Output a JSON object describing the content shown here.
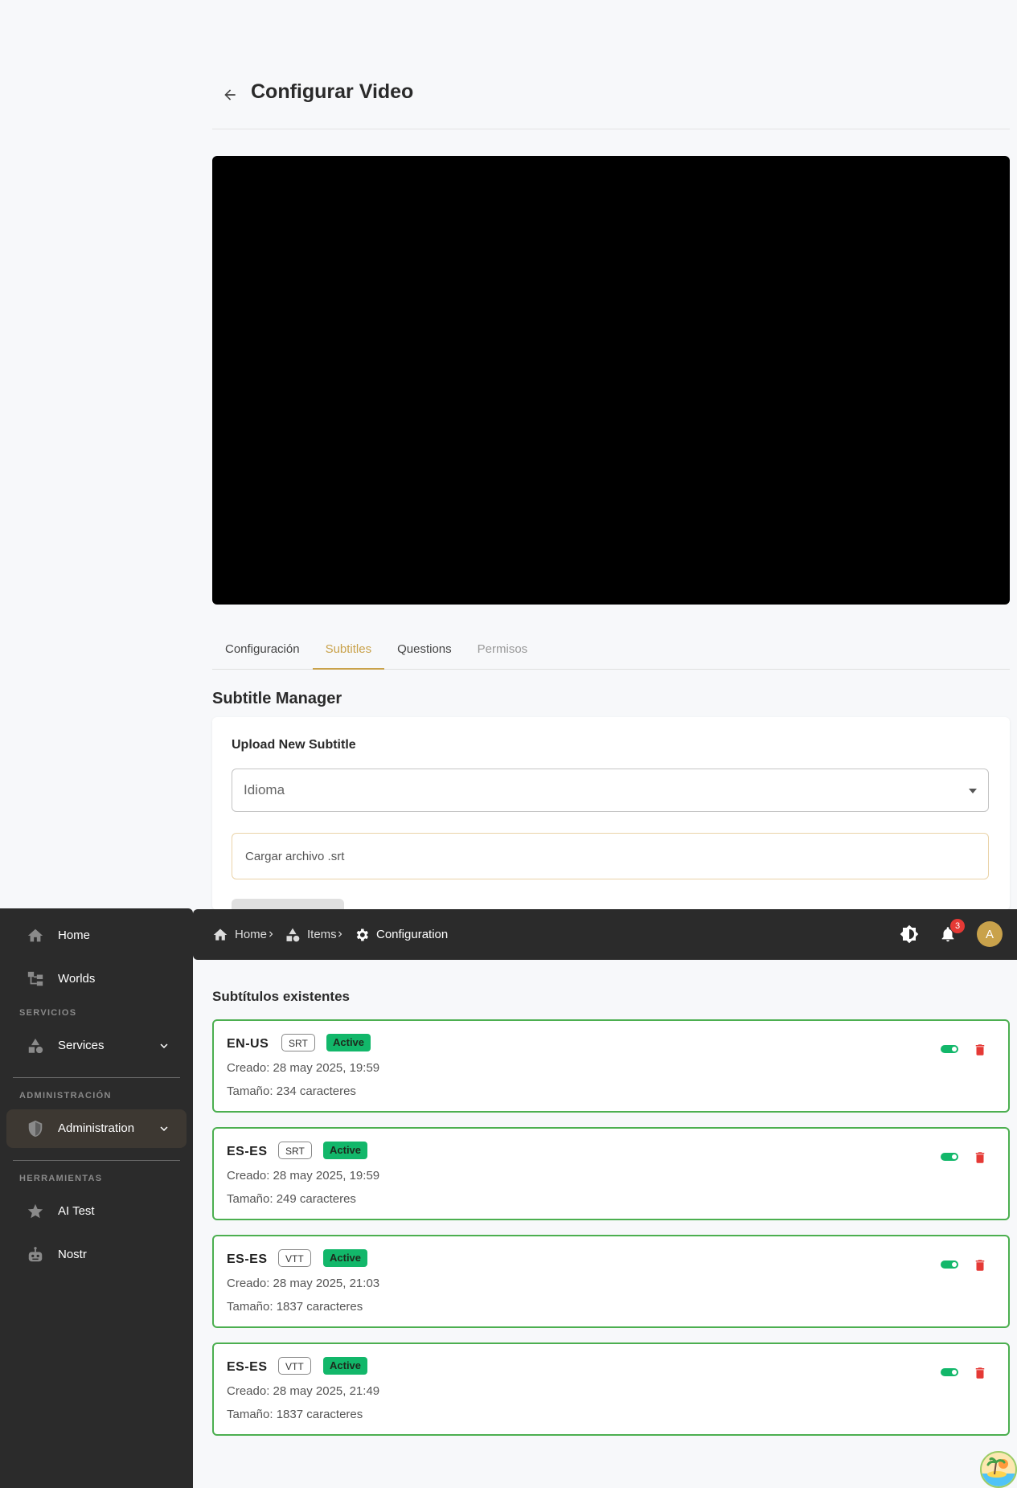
{
  "page": {
    "title": "Configurar Video"
  },
  "tabs": [
    {
      "label": "Configuración"
    },
    {
      "label": "Subtitles"
    },
    {
      "label": "Questions"
    },
    {
      "label": "Permisos"
    }
  ],
  "subtitle_manager": {
    "title": "Subtitle Manager",
    "upload": {
      "title": "Upload New Subtitle",
      "language_placeholder": "Idioma",
      "file_label": "Cargar archivo .srt"
    }
  },
  "topbar": {
    "breadcrumbs": [
      {
        "label": "Home",
        "icon": "home-icon"
      },
      {
        "label": "Items",
        "icon": "shapes-icon"
      },
      {
        "label": "Configuration",
        "icon": "gear-icon"
      }
    ],
    "notification_count": "3",
    "avatar_initial": "A"
  },
  "sidebar": {
    "items": [
      {
        "label": "Home",
        "icon": "home-icon"
      },
      {
        "label": "Worlds",
        "icon": "sitemap-icon"
      },
      {
        "label": "Services",
        "icon": "shapes-icon"
      },
      {
        "label": "Administration",
        "icon": "shield-icon"
      },
      {
        "label": "AI Test",
        "icon": "star-icon"
      },
      {
        "label": "Nostr",
        "icon": "robot-icon"
      }
    ],
    "headings": {
      "servicios": "SERVICIOS",
      "administracion": "ADMINISTRACIÓN",
      "herramientas": "HERRAMIENTAS"
    }
  },
  "existing": {
    "title": "Subtítulos existentes",
    "items": [
      {
        "lang": "EN-US",
        "format": "SRT",
        "status": "Active",
        "created": "Creado: 28 may 2025, 19:59",
        "size": "Tamaño: 234 caracteres"
      },
      {
        "lang": "ES-ES",
        "format": "SRT",
        "status": "Active",
        "created": "Creado: 28 may 2025, 19:59",
        "size": "Tamaño: 249 caracteres"
      },
      {
        "lang": "ES-ES",
        "format": "VTT",
        "status": "Active",
        "created": "Creado: 28 may 2025, 21:03",
        "size": "Tamaño: 1837 caracteres"
      },
      {
        "lang": "ES-ES",
        "format": "VTT",
        "status": "Active",
        "created": "Creado: 28 may 2025, 21:49",
        "size": "Tamaño: 1837 caracteres"
      }
    ]
  },
  "colors": {
    "accent": "#c9a24b",
    "active_green": "#12b76a",
    "card_border": "#4caf50",
    "delete_red": "#e53935",
    "dark_panel": "#2b2b2b"
  }
}
